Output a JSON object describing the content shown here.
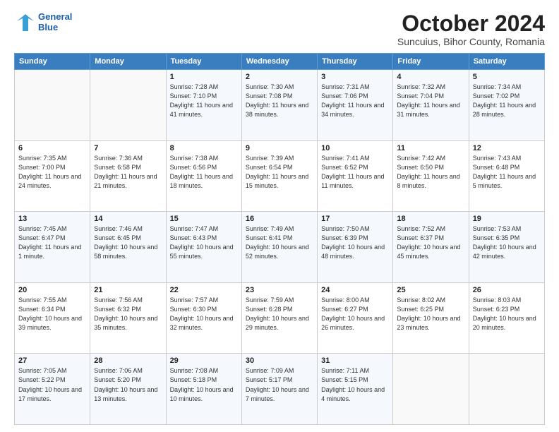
{
  "logo": {
    "line1": "General",
    "line2": "Blue"
  },
  "title": "October 2024",
  "subtitle": "Suncuius, Bihor County, Romania",
  "days_of_week": [
    "Sunday",
    "Monday",
    "Tuesday",
    "Wednesday",
    "Thursday",
    "Friday",
    "Saturday"
  ],
  "weeks": [
    [
      {
        "day": "",
        "info": ""
      },
      {
        "day": "",
        "info": ""
      },
      {
        "day": "1",
        "info": "Sunrise: 7:28 AM\nSunset: 7:10 PM\nDaylight: 11 hours and 41 minutes."
      },
      {
        "day": "2",
        "info": "Sunrise: 7:30 AM\nSunset: 7:08 PM\nDaylight: 11 hours and 38 minutes."
      },
      {
        "day": "3",
        "info": "Sunrise: 7:31 AM\nSunset: 7:06 PM\nDaylight: 11 hours and 34 minutes."
      },
      {
        "day": "4",
        "info": "Sunrise: 7:32 AM\nSunset: 7:04 PM\nDaylight: 11 hours and 31 minutes."
      },
      {
        "day": "5",
        "info": "Sunrise: 7:34 AM\nSunset: 7:02 PM\nDaylight: 11 hours and 28 minutes."
      }
    ],
    [
      {
        "day": "6",
        "info": "Sunrise: 7:35 AM\nSunset: 7:00 PM\nDaylight: 11 hours and 24 minutes."
      },
      {
        "day": "7",
        "info": "Sunrise: 7:36 AM\nSunset: 6:58 PM\nDaylight: 11 hours and 21 minutes."
      },
      {
        "day": "8",
        "info": "Sunrise: 7:38 AM\nSunset: 6:56 PM\nDaylight: 11 hours and 18 minutes."
      },
      {
        "day": "9",
        "info": "Sunrise: 7:39 AM\nSunset: 6:54 PM\nDaylight: 11 hours and 15 minutes."
      },
      {
        "day": "10",
        "info": "Sunrise: 7:41 AM\nSunset: 6:52 PM\nDaylight: 11 hours and 11 minutes."
      },
      {
        "day": "11",
        "info": "Sunrise: 7:42 AM\nSunset: 6:50 PM\nDaylight: 11 hours and 8 minutes."
      },
      {
        "day": "12",
        "info": "Sunrise: 7:43 AM\nSunset: 6:48 PM\nDaylight: 11 hours and 5 minutes."
      }
    ],
    [
      {
        "day": "13",
        "info": "Sunrise: 7:45 AM\nSunset: 6:47 PM\nDaylight: 11 hours and 1 minute."
      },
      {
        "day": "14",
        "info": "Sunrise: 7:46 AM\nSunset: 6:45 PM\nDaylight: 10 hours and 58 minutes."
      },
      {
        "day": "15",
        "info": "Sunrise: 7:47 AM\nSunset: 6:43 PM\nDaylight: 10 hours and 55 minutes."
      },
      {
        "day": "16",
        "info": "Sunrise: 7:49 AM\nSunset: 6:41 PM\nDaylight: 10 hours and 52 minutes."
      },
      {
        "day": "17",
        "info": "Sunrise: 7:50 AM\nSunset: 6:39 PM\nDaylight: 10 hours and 48 minutes."
      },
      {
        "day": "18",
        "info": "Sunrise: 7:52 AM\nSunset: 6:37 PM\nDaylight: 10 hours and 45 minutes."
      },
      {
        "day": "19",
        "info": "Sunrise: 7:53 AM\nSunset: 6:35 PM\nDaylight: 10 hours and 42 minutes."
      }
    ],
    [
      {
        "day": "20",
        "info": "Sunrise: 7:55 AM\nSunset: 6:34 PM\nDaylight: 10 hours and 39 minutes."
      },
      {
        "day": "21",
        "info": "Sunrise: 7:56 AM\nSunset: 6:32 PM\nDaylight: 10 hours and 35 minutes."
      },
      {
        "day": "22",
        "info": "Sunrise: 7:57 AM\nSunset: 6:30 PM\nDaylight: 10 hours and 32 minutes."
      },
      {
        "day": "23",
        "info": "Sunrise: 7:59 AM\nSunset: 6:28 PM\nDaylight: 10 hours and 29 minutes."
      },
      {
        "day": "24",
        "info": "Sunrise: 8:00 AM\nSunset: 6:27 PM\nDaylight: 10 hours and 26 minutes."
      },
      {
        "day": "25",
        "info": "Sunrise: 8:02 AM\nSunset: 6:25 PM\nDaylight: 10 hours and 23 minutes."
      },
      {
        "day": "26",
        "info": "Sunrise: 8:03 AM\nSunset: 6:23 PM\nDaylight: 10 hours and 20 minutes."
      }
    ],
    [
      {
        "day": "27",
        "info": "Sunrise: 7:05 AM\nSunset: 5:22 PM\nDaylight: 10 hours and 17 minutes."
      },
      {
        "day": "28",
        "info": "Sunrise: 7:06 AM\nSunset: 5:20 PM\nDaylight: 10 hours and 13 minutes."
      },
      {
        "day": "29",
        "info": "Sunrise: 7:08 AM\nSunset: 5:18 PM\nDaylight: 10 hours and 10 minutes."
      },
      {
        "day": "30",
        "info": "Sunrise: 7:09 AM\nSunset: 5:17 PM\nDaylight: 10 hours and 7 minutes."
      },
      {
        "day": "31",
        "info": "Sunrise: 7:11 AM\nSunset: 5:15 PM\nDaylight: 10 hours and 4 minutes."
      },
      {
        "day": "",
        "info": ""
      },
      {
        "day": "",
        "info": ""
      }
    ]
  ],
  "colors": {
    "header_bg": "#3a7ebf",
    "logo_blue": "#1a5fa8"
  }
}
